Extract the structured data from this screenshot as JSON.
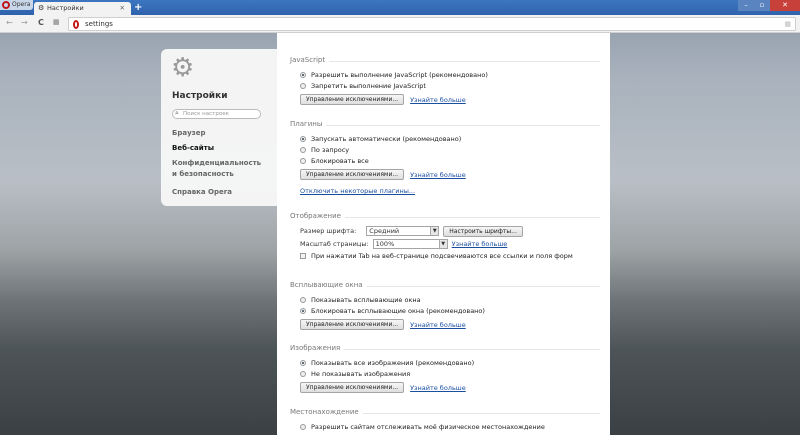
{
  "browser": {
    "menu_label": "Opera",
    "tab_title": "Настройки",
    "address": "settings"
  },
  "sidebar": {
    "title": "Настройки",
    "search_placeholder": "Поиск настроек",
    "items": [
      {
        "label": "Браузер"
      },
      {
        "label": "Веб-сайты",
        "active": true
      },
      {
        "label": "Конфиденциальность и безопасность"
      },
      {
        "label": "Справка Opera"
      }
    ]
  },
  "javascript": {
    "title": "JavaScript",
    "options": [
      "Разрешить выполнение JavaScript (рекомендовано)",
      "Запретить выполнение JavaScript"
    ],
    "selected": 0,
    "manage": "Управление исключениями...",
    "learn": "Узнайте больше"
  },
  "plugins": {
    "title": "Плагины",
    "options": [
      "Запускать автоматически (рекомендовано)",
      "По запросу",
      "Блокировать все"
    ],
    "selected": 0,
    "manage": "Управление исключениями...",
    "learn": "Узнайте больше",
    "disable_link": "Отключить некоторые плагины..."
  },
  "display": {
    "title": "Отображение",
    "font_size_label": "Размер шрифта:",
    "font_size_value": "Средний",
    "customize_fonts": "Настроить шрифты...",
    "zoom_label": "Масштаб страницы:",
    "zoom_value": "100%",
    "learn": "Узнайте больше",
    "tab_highlight": "При нажатии Tab на веб-странице подсвечиваются все ссылки и поля форм",
    "tab_highlight_checked": false
  },
  "popups": {
    "title": "Всплывающие окна",
    "options": [
      "Показывать всплывающие окна",
      "Блокировать всплывающие окна (рекомендовано)"
    ],
    "selected": 1,
    "manage": "Управление исключениями...",
    "learn": "Узнайте больше"
  },
  "images": {
    "title": "Изображения",
    "options": [
      "Показывать все изображения (рекомендовано)",
      "Не показывать изображения"
    ],
    "selected": 0,
    "manage": "Управление исключениями...",
    "learn": "Узнайте больше"
  },
  "location": {
    "title": "Местонахождение",
    "options": [
      "Разрешить сайтам отслеживать моё физическое местонахождение"
    ]
  }
}
